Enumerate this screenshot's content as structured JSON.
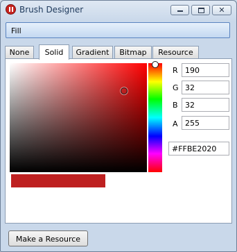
{
  "window": {
    "title": "Brush Designer",
    "close_glyph": "✕"
  },
  "fill_label": "Fill",
  "tabs": [
    {
      "label": "None",
      "active": false
    },
    {
      "label": "Solid",
      "active": true
    },
    {
      "label": "Gradient",
      "active": false
    },
    {
      "label": "Bitmap",
      "active": false
    },
    {
      "label": "Resource",
      "active": false
    }
  ],
  "color": {
    "r": "190",
    "g": "32",
    "b": "32",
    "a": "255",
    "hex": "#FFBE2020",
    "swatch": "#be2020",
    "saturation": 0.832,
    "value": 0.745,
    "hue_fraction": 0.0
  },
  "channels": {
    "r_label": "R",
    "g_label": "G",
    "b_label": "B",
    "a_label": "A"
  },
  "actions": {
    "make_resource": "Make a Resource"
  }
}
